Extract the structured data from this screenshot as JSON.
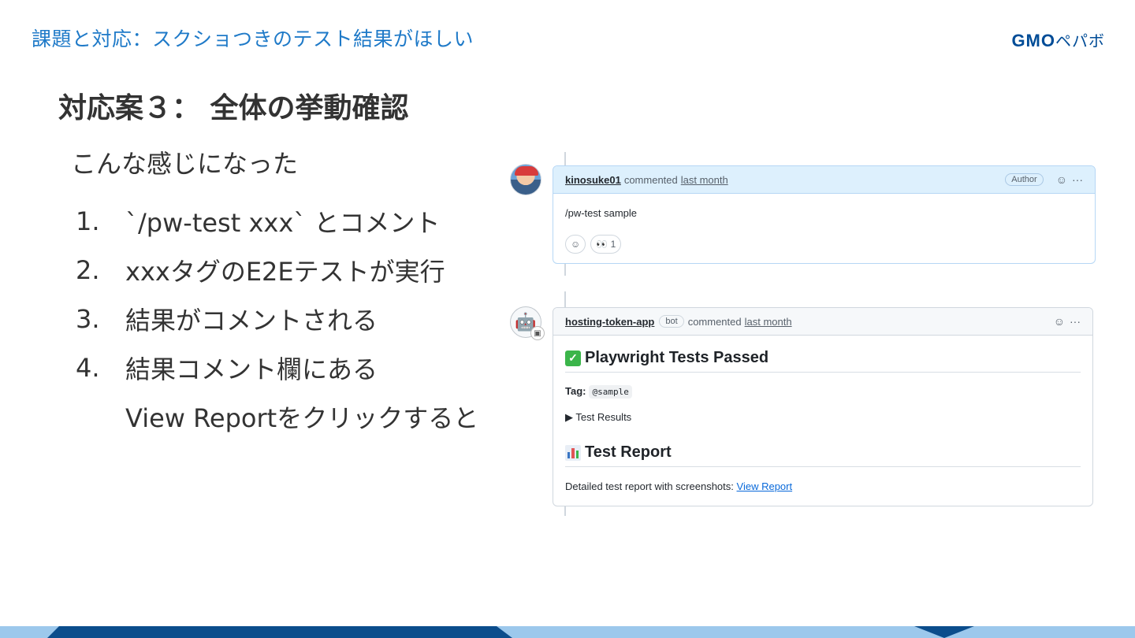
{
  "header": {
    "title": "課題と対応：スクショつきのテスト結果がほしい",
    "logo_latin": "GMO",
    "logo_kana": "ペパボ"
  },
  "slide": {
    "heading": "対応案３： 全体の挙動確認",
    "lead": "こんな感じになった",
    "steps": [
      {
        "num": "1.",
        "text": "`/pw-test xxx` とコメント"
      },
      {
        "num": "2.",
        "text": "xxxタグのE2Eテストが実行"
      },
      {
        "num": "3.",
        "text": "結果がコメントされる"
      },
      {
        "num": "4.",
        "text": "結果コメント欄にある"
      },
      {
        "num": "",
        "text": "View Reportをクリックすると"
      }
    ]
  },
  "comments": [
    {
      "author": "kinosuke01",
      "action": "commented",
      "when": "last month",
      "badge": "Author",
      "body": "/pw-test sample",
      "reaction_eyes": "👀",
      "reaction_count": "1"
    },
    {
      "author": "hosting-token-app",
      "bot_label": "bot",
      "action": "commented",
      "when": "last month",
      "heading1": "Playwright Tests Passed",
      "tag_label": "Tag:",
      "tag_value": "@sample",
      "details_label": "▶ Test Results",
      "heading2": "Test Report",
      "detail_text": "Detailed test report with screenshots:",
      "link_text": "View Report"
    }
  ],
  "icons": {
    "smiley": "☺",
    "more": "···",
    "check": "✓",
    "robot": "🤖"
  },
  "colors": {
    "header_blue": "#1f7ac8",
    "logo_blue": "#004c97",
    "link_blue": "#0969da",
    "footer_light": "#9cc8ec",
    "footer_dark": "#0b4d8c"
  }
}
